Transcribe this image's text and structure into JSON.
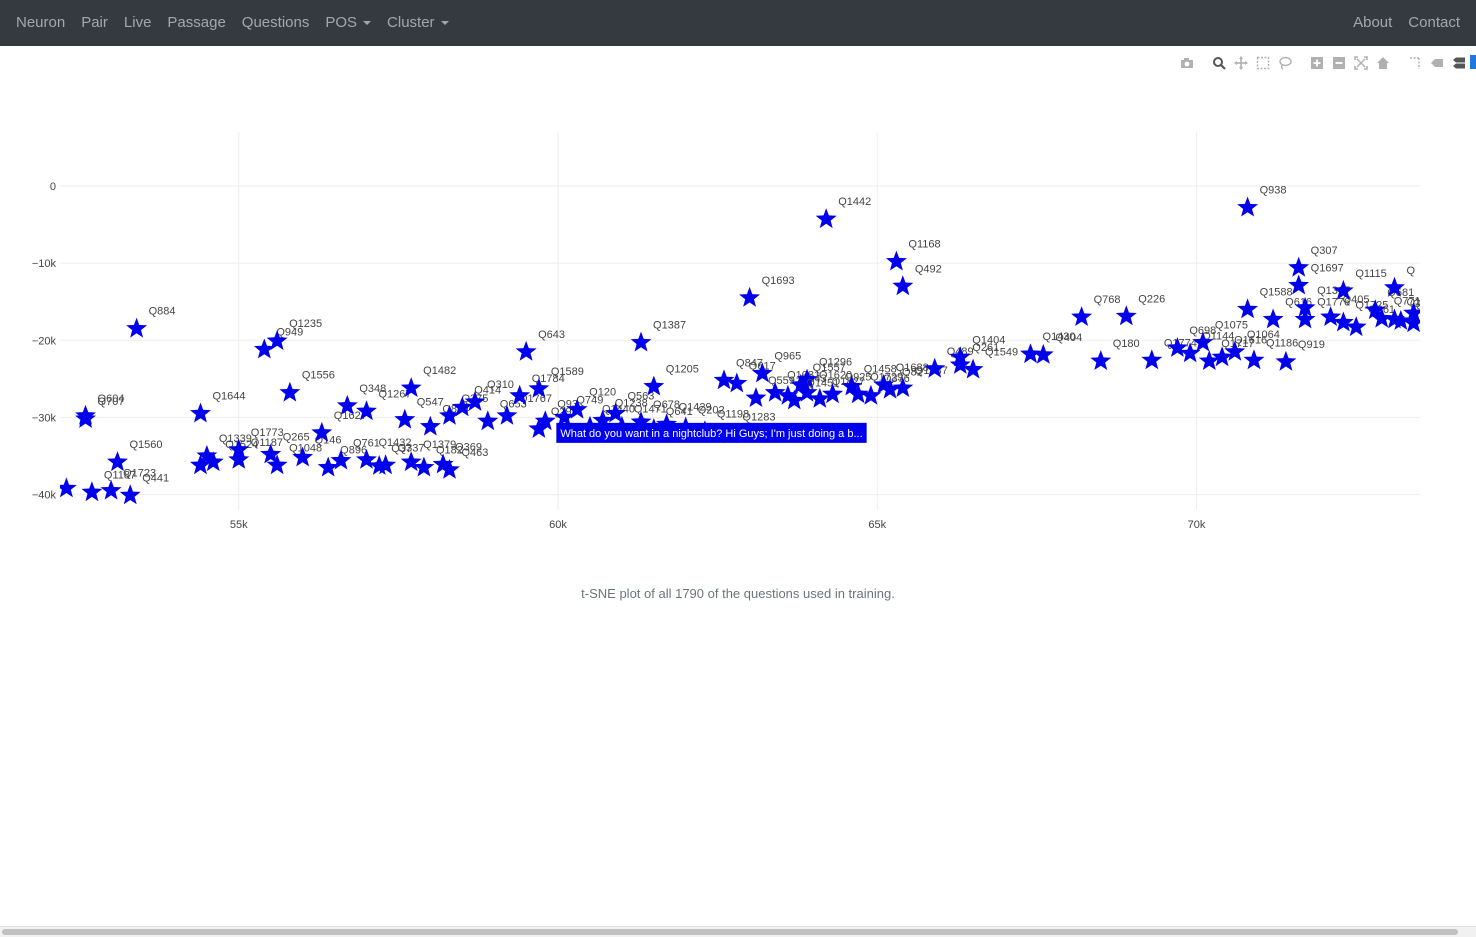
{
  "nav": {
    "left": [
      "Neuron",
      "Pair",
      "Live",
      "Passage",
      "Questions",
      "POS",
      "Cluster"
    ],
    "right": [
      "About",
      "Contact"
    ]
  },
  "modebar": [
    "camera-icon",
    "zoom-icon",
    "pan-icon",
    "box-select-icon",
    "lasso-icon",
    "zoom-in-icon",
    "zoom-out-icon",
    "autoscale-icon",
    "reset-axes-icon",
    "spike-lines-icon",
    "hover-closest-icon",
    "hover-compare-icon"
  ],
  "caption": "t-SNE plot of all 1790 of the questions used in training.",
  "colors": {
    "marker": "#0000ee",
    "navbar": "#343a40"
  },
  "chart_data": {
    "type": "scatter",
    "marker": "star",
    "xlim": [
      52200,
      73500
    ],
    "ylim": [
      -42000,
      7000
    ],
    "xticks": [
      55000,
      60000,
      65000,
      70000
    ],
    "xtick_labels": [
      "55k",
      "60k",
      "65k",
      "70k"
    ],
    "yticks": [
      0,
      -10000,
      -20000,
      -30000,
      -40000
    ],
    "ytick_labels": [
      "0",
      "−10k",
      "−20k",
      "−30k",
      "−40k"
    ],
    "grid": true,
    "tooltip": {
      "x": 60600,
      "y": -32000,
      "text": "What do you want in a nightclub? Hi Guys; I'm just doing a b..."
    },
    "points": [
      {
        "x": 53400,
        "y": -18500,
        "label": "Q884"
      },
      {
        "x": 52600,
        "y": -29800,
        "label": "Q604"
      },
      {
        "x": 52600,
        "y": -30200,
        "label": "Q707"
      },
      {
        "x": 52300,
        "y": -39200,
        "label": ""
      },
      {
        "x": 52700,
        "y": -39700,
        "label": "Q1187"
      },
      {
        "x": 53100,
        "y": -35800,
        "label": "Q1560"
      },
      {
        "x": 53300,
        "y": -40100,
        "label": "Q441"
      },
      {
        "x": 53000,
        "y": -39500,
        "label": "Q1723"
      },
      {
        "x": 54400,
        "y": -29500,
        "label": "Q1644"
      },
      {
        "x": 54500,
        "y": -35000,
        "label": "Q1339"
      },
      {
        "x": 54600,
        "y": -35800,
        "label": "Q1524"
      },
      {
        "x": 54400,
        "y": -36200,
        "label": ""
      },
      {
        "x": 55000,
        "y": -34200,
        "label": "Q1773"
      },
      {
        "x": 55000,
        "y": -35500,
        "label": "Q1187"
      },
      {
        "x": 55400,
        "y": -21200,
        "label": "Q949"
      },
      {
        "x": 55600,
        "y": -20100,
        "label": "Q1235"
      },
      {
        "x": 55800,
        "y": -26800,
        "label": "Q1556"
      },
      {
        "x": 55500,
        "y": -34800,
        "label": "Q265"
      },
      {
        "x": 55600,
        "y": -36200,
        "label": "Q1048"
      },
      {
        "x": 56000,
        "y": -35200,
        "label": "Q146"
      },
      {
        "x": 56300,
        "y": -32000,
        "label": "Q1627"
      },
      {
        "x": 56400,
        "y": -36500,
        "label": "Q896"
      },
      {
        "x": 56600,
        "y": -35600,
        "label": "Q761"
      },
      {
        "x": 56700,
        "y": -28500,
        "label": "Q348"
      },
      {
        "x": 57000,
        "y": -29200,
        "label": "Q1267"
      },
      {
        "x": 57000,
        "y": -35500,
        "label": "Q1432"
      },
      {
        "x": 57200,
        "y": -36300,
        "label": "Q37"
      },
      {
        "x": 57300,
        "y": -36200,
        "label": "Q337"
      },
      {
        "x": 57700,
        "y": -26200,
        "label": "Q1482"
      },
      {
        "x": 57600,
        "y": -30300,
        "label": "Q547"
      },
      {
        "x": 57700,
        "y": -35800,
        "label": "Q1379"
      },
      {
        "x": 57900,
        "y": -36500,
        "label": "Q182"
      },
      {
        "x": 58200,
        "y": -36100,
        "label": "Q369"
      },
      {
        "x": 58300,
        "y": -36800,
        "label": "Q463"
      },
      {
        "x": 58000,
        "y": -31200,
        "label": "Q834"
      },
      {
        "x": 58300,
        "y": -29800,
        "label": "Q375"
      },
      {
        "x": 58500,
        "y": -28700,
        "label": "Q414"
      },
      {
        "x": 58700,
        "y": -28000,
        "label": "Q310"
      },
      {
        "x": 58900,
        "y": -30500,
        "label": "Q653"
      },
      {
        "x": 59200,
        "y": -29800,
        "label": "Q1767"
      },
      {
        "x": 59400,
        "y": -27200,
        "label": "Q1784"
      },
      {
        "x": 59500,
        "y": -21500,
        "label": "Q643"
      },
      {
        "x": 59700,
        "y": -26300,
        "label": "Q1589"
      },
      {
        "x": 59700,
        "y": -31500,
        "label": "Q299"
      },
      {
        "x": 59800,
        "y": -30500,
        "label": "Q93"
      },
      {
        "x": 60100,
        "y": -30000,
        "label": "Q749"
      },
      {
        "x": 60300,
        "y": -29000,
        "label": "Q120"
      },
      {
        "x": 60500,
        "y": -31200,
        "label": "Q1440"
      },
      {
        "x": 60700,
        "y": -30400,
        "label": "Q1238"
      },
      {
        "x": 60900,
        "y": -29500,
        "label": "Q563"
      },
      {
        "x": 61000,
        "y": -31200,
        "label": "Q1471"
      },
      {
        "x": 61300,
        "y": -30600,
        "label": "Q678"
      },
      {
        "x": 61500,
        "y": -31500,
        "label": "Q641"
      },
      {
        "x": 61700,
        "y": -30900,
        "label": "Q1429"
      },
      {
        "x": 61300,
        "y": -20300,
        "label": "Q1387"
      },
      {
        "x": 61500,
        "y": -26000,
        "label": "Q1205"
      },
      {
        "x": 62000,
        "y": -31300,
        "label": "Q202"
      },
      {
        "x": 62300,
        "y": -31800,
        "label": "Q1198"
      },
      {
        "x": 62700,
        "y": -32200,
        "label": "Q1283"
      },
      {
        "x": 62600,
        "y": -25200,
        "label": "Q847"
      },
      {
        "x": 62800,
        "y": -25600,
        "label": "Q617"
      },
      {
        "x": 63200,
        "y": -24300,
        "label": "Q965"
      },
      {
        "x": 63000,
        "y": -14500,
        "label": "Q1693"
      },
      {
        "x": 63100,
        "y": -27500,
        "label": "Q559"
      },
      {
        "x": 63400,
        "y": -26800,
        "label": "Q1081"
      },
      {
        "x": 63600,
        "y": -27200,
        "label": "Q643"
      },
      {
        "x": 63800,
        "y": -25800,
        "label": "Q1557"
      },
      {
        "x": 63900,
        "y": -25100,
        "label": "Q1296"
      },
      {
        "x": 63700,
        "y": -27800,
        "label": "Q1451"
      },
      {
        "x": 63900,
        "y": -26800,
        "label": "Q1620"
      },
      {
        "x": 64100,
        "y": -27600,
        "label": "Q1827"
      },
      {
        "x": 64300,
        "y": -27000,
        "label": "Q925"
      },
      {
        "x": 64200,
        "y": -4300,
        "label": "Q1442"
      },
      {
        "x": 64600,
        "y": -26000,
        "label": "Q1458"
      },
      {
        "x": 64700,
        "y": -27000,
        "label": "Q1729"
      },
      {
        "x": 64900,
        "y": -27200,
        "label": "Q376"
      },
      {
        "x": 65100,
        "y": -25800,
        "label": "Q1688"
      },
      {
        "x": 65200,
        "y": -26400,
        "label": "Q82"
      },
      {
        "x": 65400,
        "y": -26200,
        "label": "Q1537"
      },
      {
        "x": 65300,
        "y": -9800,
        "label": "Q1168"
      },
      {
        "x": 65400,
        "y": -13000,
        "label": "Q492"
      },
      {
        "x": 65900,
        "y": -23700,
        "label": "Q489"
      },
      {
        "x": 66300,
        "y": -23200,
        "label": "Q261"
      },
      {
        "x": 66300,
        "y": -22200,
        "label": "Q1404"
      },
      {
        "x": 66500,
        "y": -23800,
        "label": "Q1549"
      },
      {
        "x": 67400,
        "y": -21800,
        "label": "Q1430"
      },
      {
        "x": 67600,
        "y": -21900,
        "label": "Q404"
      },
      {
        "x": 68200,
        "y": -17000,
        "label": "Q768"
      },
      {
        "x": 68500,
        "y": -22700,
        "label": "Q180"
      },
      {
        "x": 68900,
        "y": -16900,
        "label": "Q226"
      },
      {
        "x": 69300,
        "y": -22600,
        "label": "Q1774"
      },
      {
        "x": 69700,
        "y": -21000,
        "label": "Q698"
      },
      {
        "x": 69900,
        "y": -21700,
        "label": "Q1144"
      },
      {
        "x": 70100,
        "y": -20300,
        "label": "Q1075"
      },
      {
        "x": 70200,
        "y": -22700,
        "label": "Q1717"
      },
      {
        "x": 70400,
        "y": -22200,
        "label": "Q1616"
      },
      {
        "x": 70600,
        "y": -21500,
        "label": "Q1064"
      },
      {
        "x": 70900,
        "y": -22600,
        "label": "Q1186"
      },
      {
        "x": 70800,
        "y": -16000,
        "label": "Q1588"
      },
      {
        "x": 71200,
        "y": -17300,
        "label": "Q616"
      },
      {
        "x": 71400,
        "y": -22800,
        "label": "Q919"
      },
      {
        "x": 70800,
        "y": -2800,
        "label": "Q938"
      },
      {
        "x": 71700,
        "y": -17300,
        "label": "Q1776"
      },
      {
        "x": 71600,
        "y": -10600,
        "label": "Q307"
      },
      {
        "x": 71600,
        "y": -12900,
        "label": "Q1697"
      },
      {
        "x": 71700,
        "y": -15800,
        "label": "Q1317"
      },
      {
        "x": 72100,
        "y": -17000,
        "label": "Q405"
      },
      {
        "x": 72300,
        "y": -17700,
        "label": "Q1725"
      },
      {
        "x": 72500,
        "y": -18300,
        "label": "Q861"
      },
      {
        "x": 72300,
        "y": -13600,
        "label": "Q1115"
      },
      {
        "x": 72800,
        "y": -16100,
        "label": "Q581"
      },
      {
        "x": 72900,
        "y": -17200,
        "label": "Q771"
      },
      {
        "x": 73100,
        "y": -17300,
        "label": "Q1144"
      },
      {
        "x": 73200,
        "y": -17500,
        "label": "Q857"
      },
      {
        "x": 73400,
        "y": -17800,
        "label": "Q8"
      },
      {
        "x": 73100,
        "y": -13200,
        "label": "Q"
      },
      {
        "x": 73400,
        "y": -16500,
        "label": "Q"
      }
    ]
  }
}
